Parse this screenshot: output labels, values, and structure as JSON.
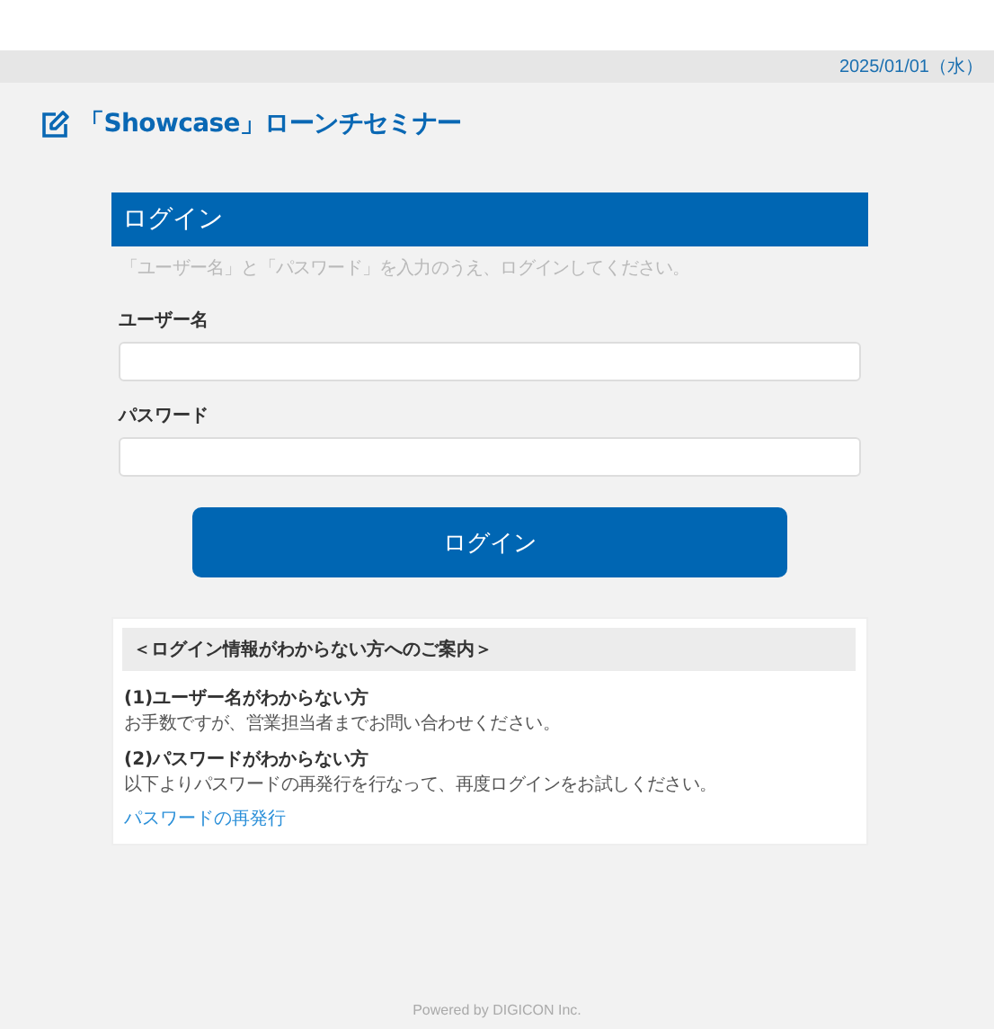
{
  "header": {
    "date": "2025/01/01（水）"
  },
  "page_title": "「Showcase」ローンチセミナー",
  "login": {
    "heading": "ログイン",
    "instruction": "「ユーザー名」と「パスワード」を入力のうえ、ログインしてください。",
    "fields": [
      {
        "label": "ユーザー名"
      },
      {
        "label": "パスワード"
      }
    ],
    "button": "ログイン"
  },
  "help": {
    "title": "＜ログイン情報がわからない方へのご案内＞",
    "sections": [
      {
        "heading": "(1)ユーザー名がわからない方",
        "text": "お手数ですが、営業担当者までお問い合わせください。"
      },
      {
        "heading": "(2)パスワードがわからない方",
        "text": "以下よりパスワードの再発行を行なって、再度ログインをお試しください。",
        "link": "パスワードの再発行"
      }
    ]
  },
  "footer": "Powered by DIGICON Inc."
}
